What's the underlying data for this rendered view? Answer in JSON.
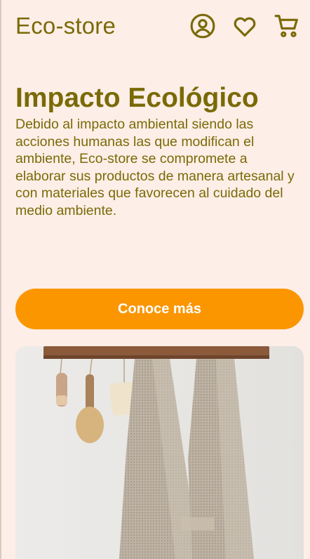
{
  "header": {
    "brand": "Eco-store",
    "icons": [
      "user-circle-icon",
      "heart-icon",
      "cart-icon"
    ]
  },
  "hero": {
    "title": "Impacto Ecológico",
    "description": "Debido al impacto ambiental siendo las acciones humanas las que modifican el ambiente, Eco-store se compromete a elaborar sus productos de manera artesanal y con materiales que favorecen al cuidado del medio ambiente.",
    "cta_label": "Conoce más"
  },
  "colors": {
    "background": "#fdeee7",
    "text": "#7a6a07",
    "accent": "#fb9600"
  }
}
